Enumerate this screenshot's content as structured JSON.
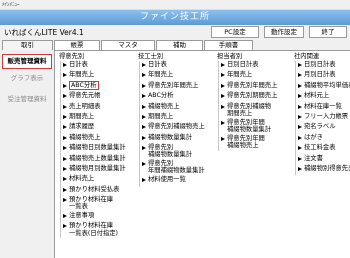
{
  "window": {
    "caption": "ﾒｲﾝﾒﾆｭｰ"
  },
  "header": {
    "title": "ファイン技工所"
  },
  "toolbar": {
    "version": "いればくんLITE Ver4.1",
    "pc_settings": "PC設定",
    "op_settings": "動作設定",
    "exit": "終了"
  },
  "tabs": [
    {
      "label": "取引",
      "active": false
    },
    {
      "label": "帳票",
      "active": true
    },
    {
      "label": "マスタ",
      "active": false
    },
    {
      "label": "補助",
      "active": false
    },
    {
      "label": "手順書",
      "active": false
    }
  ],
  "sidebar": {
    "items": [
      {
        "label": "販売管理資料",
        "active": true
      },
      {
        "label": "グラフ表示",
        "active": false
      },
      {
        "label": "受注管理資料",
        "active": false
      }
    ]
  },
  "columns": [
    {
      "header": "得意先別",
      "items": [
        "日計表",
        "年間売上",
        "ABC分析",
        "得意先元帳",
        "売上明細表",
        "期間売上",
        "請求履歴",
        "補綴物売上",
        "補綴物日別数量集計",
        "補綴物売上数量集計",
        "補綴物月別数量集計",
        "材料売上",
        "預かり材料受払表",
        "預かり材料在庫\n一覧表",
        "注意事項",
        "預かり材料在庫\n一覧表(日付指定)"
      ],
      "highlighted_index": 2
    },
    {
      "header": "技工士別",
      "items": [
        "日計表",
        "年間売上",
        "得意先別年間売上",
        "ABC分析",
        "補綴物売上",
        "期間売上",
        "得意先別補綴物売上",
        "補綴物数量集計",
        "得意先別\n補綴物数量集計",
        "得意先別\n年間補綴物数量集計",
        "材料使用一覧"
      ]
    },
    {
      "header": "担当者別",
      "items": [
        "日別日計表",
        "年間売上",
        "得意先別年間売上",
        "得意先別期間売上",
        "得意先別補綴物\n期間売上",
        "得意先別年間\n補綴物数量集計",
        "得意先別年間\n補綴物売上"
      ]
    },
    {
      "header": "社内関連",
      "items": [
        "日別日計表",
        "月別日計表",
        "補綴物平均単価表",
        "材料元上",
        "材料在庫一覧",
        "フリー入力帳票",
        "宛名ラベル",
        "はがき",
        "技工料金表",
        "注文書",
        "補綴物別得意先売上"
      ]
    }
  ]
}
